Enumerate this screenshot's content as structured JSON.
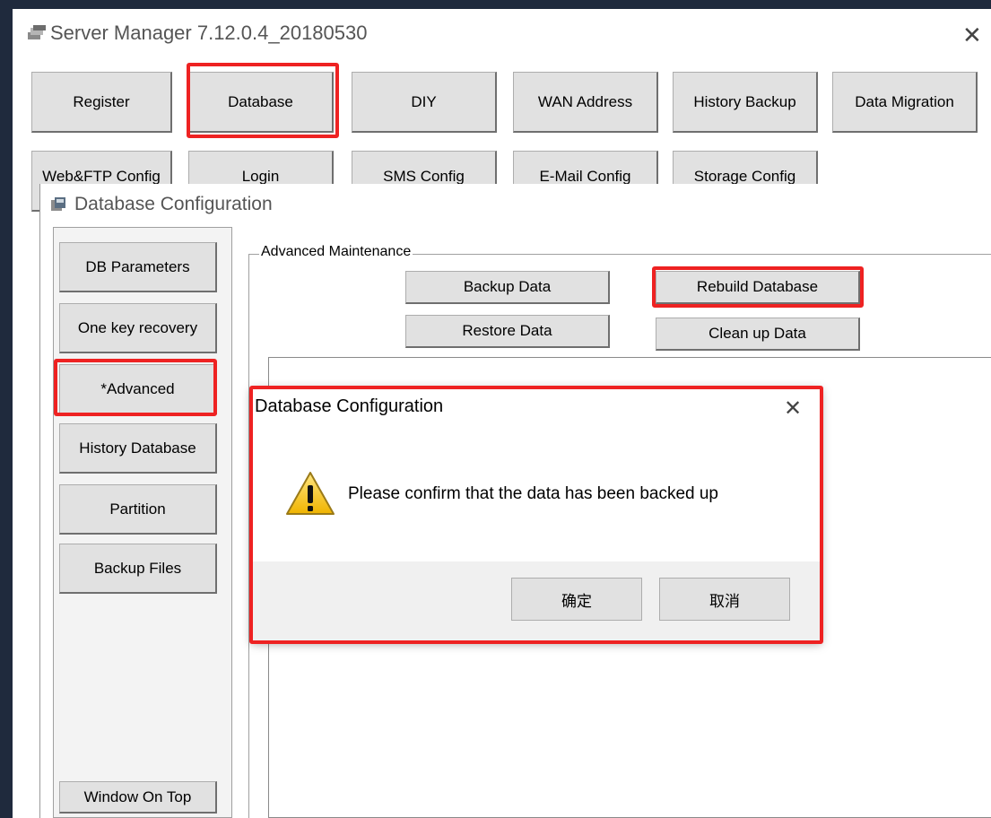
{
  "server_window": {
    "title": "Server Manager 7.12.0.4_20180530",
    "close_symbol": "✕",
    "top_buttons_row1": [
      "Register",
      "Database",
      "DIY",
      "WAN Address",
      "History Backup",
      "Data Migration"
    ],
    "top_buttons_row2": [
      "Web&FTP Config",
      "Login",
      "SMS Config",
      "E-Mail Config",
      "Storage Config"
    ]
  },
  "db_config_window": {
    "title": "Database Configuration",
    "sidebar": [
      "DB Parameters",
      "One key recovery",
      "*Advanced",
      "History Database",
      "Partition",
      "Backup Files"
    ],
    "window_on_top_label": "Window On Top",
    "group_title": "Advanced Maintenance",
    "maintenance_buttons": {
      "backup": "Backup Data",
      "rebuild": "Rebuild Database",
      "restore": "Restore Data",
      "cleanup": "Clean up Data"
    }
  },
  "dialog": {
    "title": "Database Configuration",
    "close_symbol": "✕",
    "message": "Please confirm that the data has been backed up",
    "ok_label": "确定",
    "cancel_label": "取消",
    "icon": "warning-icon"
  },
  "colors": {
    "highlight": "#ee2222",
    "desktop_background": "#1f2a3d",
    "window_background": "#ffffff",
    "button_face": "#e1e1e1"
  }
}
